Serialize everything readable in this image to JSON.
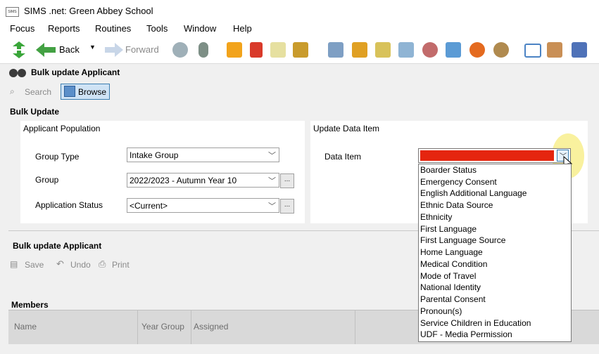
{
  "window": {
    "title": "SIMS .net: Green Abbey School",
    "icon_text": "SIMS"
  },
  "menu": [
    "Focus",
    "Reports",
    "Routines",
    "Tools",
    "Window",
    "Help"
  ],
  "toolbar": {
    "back_label": "Back",
    "forward_label": "Forward"
  },
  "page": {
    "title": "Bulk update Applicant",
    "search_label": "Search",
    "browse_label": "Browse"
  },
  "bulk_update": {
    "heading": "Bulk Update",
    "population_heading": "Applicant Population",
    "update_heading": "Update Data Item",
    "fields": {
      "group_type_label": "Group Type",
      "group_type_value": "Intake Group",
      "group_label": "Group",
      "group_value": "2022/2023 - Autumn Year 10",
      "status_label": "Application Status",
      "status_value": "<Current>",
      "data_item_label": "Data Item",
      "ellipsis": "..."
    }
  },
  "dropdown_options": [
    "Boarder Status",
    "Emergency Consent",
    "English Additional Language",
    "Ethnic Data Source",
    "Ethnicity",
    "First Language",
    "First Language Source",
    "Home Language",
    "Medical Condition",
    "Mode of Travel",
    "National Identity",
    "Parental Consent",
    "Pronoun(s)",
    "Service Children in Education",
    "UDF - Media Permission"
  ],
  "bulk_section": {
    "heading": "Bulk update Applicant",
    "save_label": "Save",
    "undo_label": "Undo",
    "print_label": "Print"
  },
  "members": {
    "heading": "Members",
    "columns": [
      "Name",
      "Year Group",
      "Assigned"
    ]
  },
  "colors": {
    "accent_red": "#e5250f",
    "highlight": "#f7ee86"
  }
}
